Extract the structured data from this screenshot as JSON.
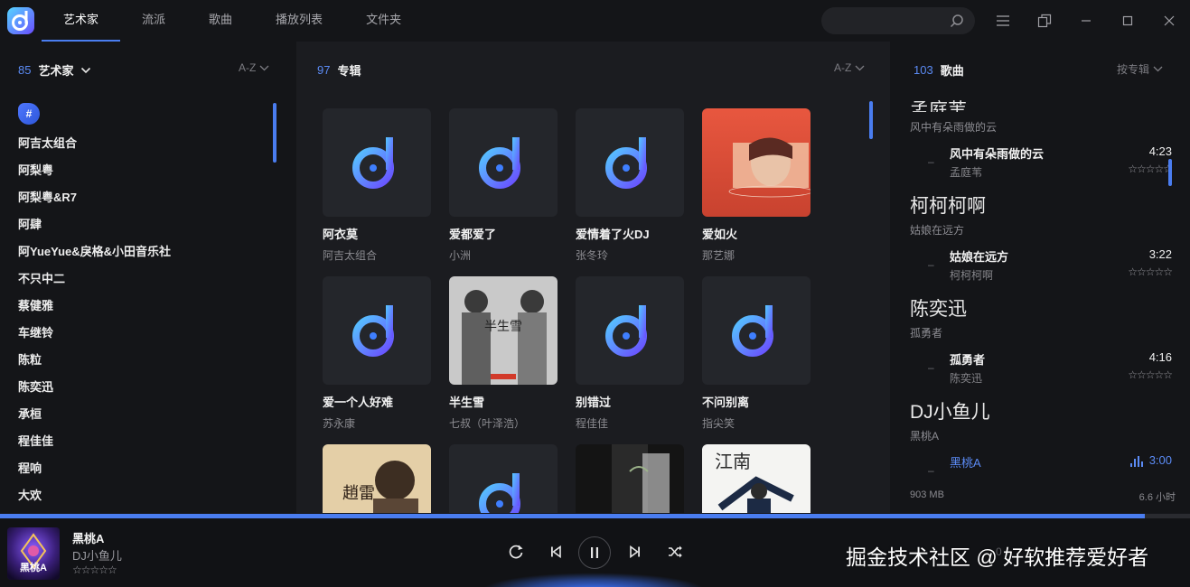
{
  "colors": {
    "accent": "#4a7df0",
    "accent_text": "#5b8bf5",
    "bg": "#16171b"
  },
  "header": {
    "tabs": [
      {
        "label": "艺术家",
        "active": true
      },
      {
        "label": "流派"
      },
      {
        "label": "歌曲"
      },
      {
        "label": "播放列表"
      },
      {
        "label": "文件夹"
      }
    ],
    "search": {
      "placeholder": "",
      "icon": "search-icon"
    },
    "window_buttons": [
      "menu-icon",
      "miniplayer-icon",
      "minimize-icon",
      "maximize-icon",
      "close-icon"
    ]
  },
  "artists": {
    "count": "85",
    "label": "艺术家",
    "sort": "A-Z",
    "index_letter": "#",
    "items": [
      "阿吉太组合",
      "阿梨粤",
      "阿梨粤&R7",
      "阿肆",
      "阿YueYue&戾格&小田音乐社",
      "不只中二",
      "蔡健雅",
      "车继铃",
      "陈粒",
      "陈奕迅",
      "承桓",
      "程佳佳",
      "程响",
      "大欢"
    ]
  },
  "albums": {
    "count": "97",
    "label": "专辑",
    "sort": "A-Z",
    "items": [
      {
        "title": "阿衣莫",
        "artist": "阿吉太组合",
        "cover": "placeholder"
      },
      {
        "title": "爱都爱了",
        "artist": "小洲",
        "cover": "placeholder"
      },
      {
        "title": "爱情着了火DJ",
        "artist": "张冬玲",
        "cover": "placeholder"
      },
      {
        "title": "爱如火",
        "artist": "那艺娜",
        "cover": "photo-red"
      },
      {
        "title": "爱一个人好难",
        "artist": "苏永康",
        "cover": "placeholder"
      },
      {
        "title": "半生雪",
        "artist": "七叔（叶泽浩）",
        "cover": "photo-gray"
      },
      {
        "title": "别错过",
        "artist": "程佳佳",
        "cover": "placeholder"
      },
      {
        "title": "不问别离",
        "artist": "指尖笑",
        "cover": "placeholder"
      },
      {
        "title": "",
        "artist": "",
        "cover": "photo-sepia"
      },
      {
        "title": "",
        "artist": "",
        "cover": "placeholder"
      },
      {
        "title": "",
        "artist": "",
        "cover": "photo-dark"
      },
      {
        "title": "",
        "artist": "",
        "cover": "photo-light"
      }
    ]
  },
  "songs": {
    "count": "103",
    "label": "歌曲",
    "sort": "按专辑",
    "partial_group": "孟庭苇",
    "groups": [
      {
        "artist": "",
        "album": "风中有朵雨做的云",
        "songs": [
          {
            "title": "风中有朵雨做的云",
            "artist": "孟庭苇",
            "duration": "4:23",
            "rating": "☆☆☆☆☆"
          }
        ]
      },
      {
        "artist": "柯柯柯啊",
        "album": "姑娘在远方",
        "songs": [
          {
            "title": "姑娘在远方",
            "artist": "柯柯柯啊",
            "duration": "3:22",
            "rating": "☆☆☆☆☆"
          }
        ]
      },
      {
        "artist": "陈奕迅",
        "album": "孤勇者",
        "songs": [
          {
            "title": "孤勇者",
            "artist": "陈奕迅",
            "duration": "4:16",
            "rating": "☆☆☆☆☆"
          }
        ]
      },
      {
        "artist": "DJ小鱼儿",
        "album": "黑桃A",
        "songs": [
          {
            "title": "黑桃A",
            "artist": "",
            "duration": "3:00",
            "playing": true
          }
        ]
      }
    ],
    "footer_size": "903 MB",
    "footer_time": "6.6 小时"
  },
  "player": {
    "title": "黑桃A",
    "artist": "DJ小鱼儿",
    "rating": "☆☆☆☆☆",
    "cover_text": "黑桃A",
    "progress": 0.962,
    "time_partial": "0",
    "controls": [
      "repeat-icon",
      "previous-icon",
      "pause-icon",
      "next-icon",
      "shuffle-icon"
    ]
  },
  "watermark": "掘金技术社区 @ 好软推荐爱好者"
}
